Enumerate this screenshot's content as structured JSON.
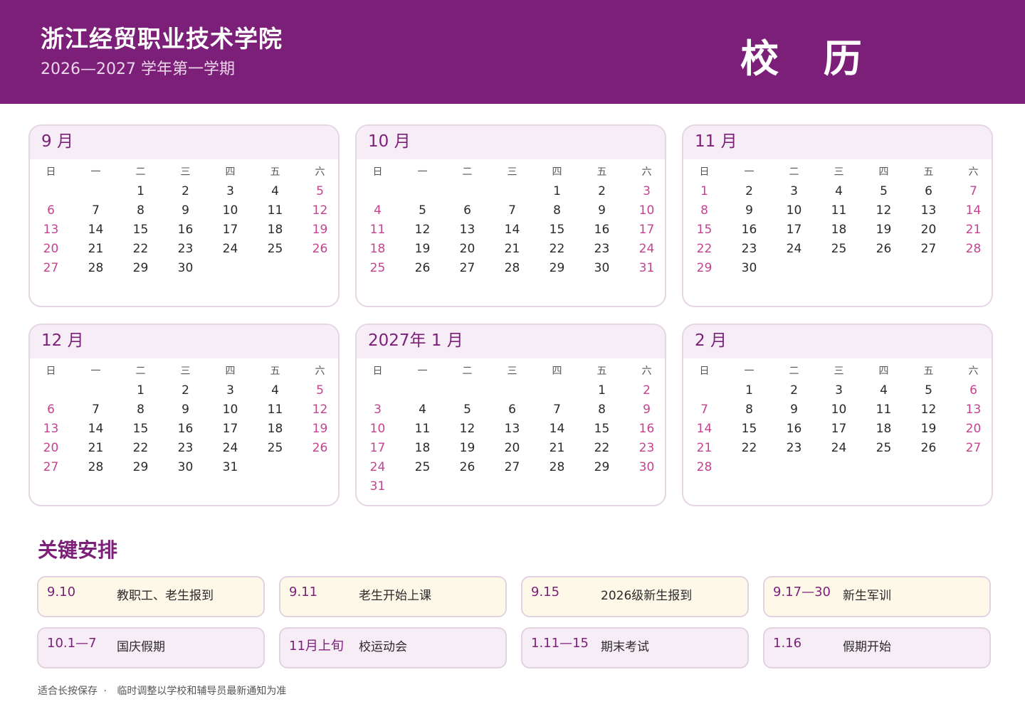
{
  "header": {
    "school": "浙江经贸职业技术学院",
    "semester": "2026—2027 学年第一学期",
    "title": "校 历"
  },
  "weekdays": [
    "日",
    "一",
    "二",
    "三",
    "四",
    "五",
    "六"
  ],
  "months": [
    {
      "label": "9 月",
      "offset": 2,
      "days": 30
    },
    {
      "label": "10 月",
      "offset": 4,
      "days": 31
    },
    {
      "label": "11 月",
      "offset": 0,
      "days": 30
    },
    {
      "label": "12 月",
      "offset": 2,
      "days": 31
    },
    {
      "label": "2027年 1 月",
      "offset": 5,
      "days": 31
    },
    {
      "label": "2 月",
      "offset": 1,
      "days": 28
    }
  ],
  "section": {
    "title": "关键安排"
  },
  "events": [
    {
      "date": "9.10",
      "text": "教职工、老生报到",
      "style": "yellow"
    },
    {
      "date": "9.11",
      "text": "老生开始上课",
      "style": "yellow"
    },
    {
      "date": "9.15",
      "text": "2026级新生报到",
      "style": "yellow"
    },
    {
      "date": "9.17—30",
      "text": "新生军训",
      "style": "yellow"
    },
    {
      "date": "10.1—7",
      "text": "国庆假期",
      "style": "purple"
    },
    {
      "date": "11月上旬",
      "text": "校运动会",
      "style": "purple"
    },
    {
      "date": "1.11—15",
      "text": "期末考试",
      "style": "purple"
    },
    {
      "date": "1.16",
      "text": "假期开始",
      "style": "purple"
    }
  ],
  "footer": {
    "left": "适合长按保存",
    "separator": "·",
    "right": "临时调整以学校和辅导员最新通知为准"
  },
  "colors": {
    "brand": "#7b1f78",
    "weekend": "#c4438f",
    "month_header_bg": "#f7edf7",
    "event_yellow_bg": "#fef8e8",
    "event_purple_bg": "#f7edf7"
  }
}
